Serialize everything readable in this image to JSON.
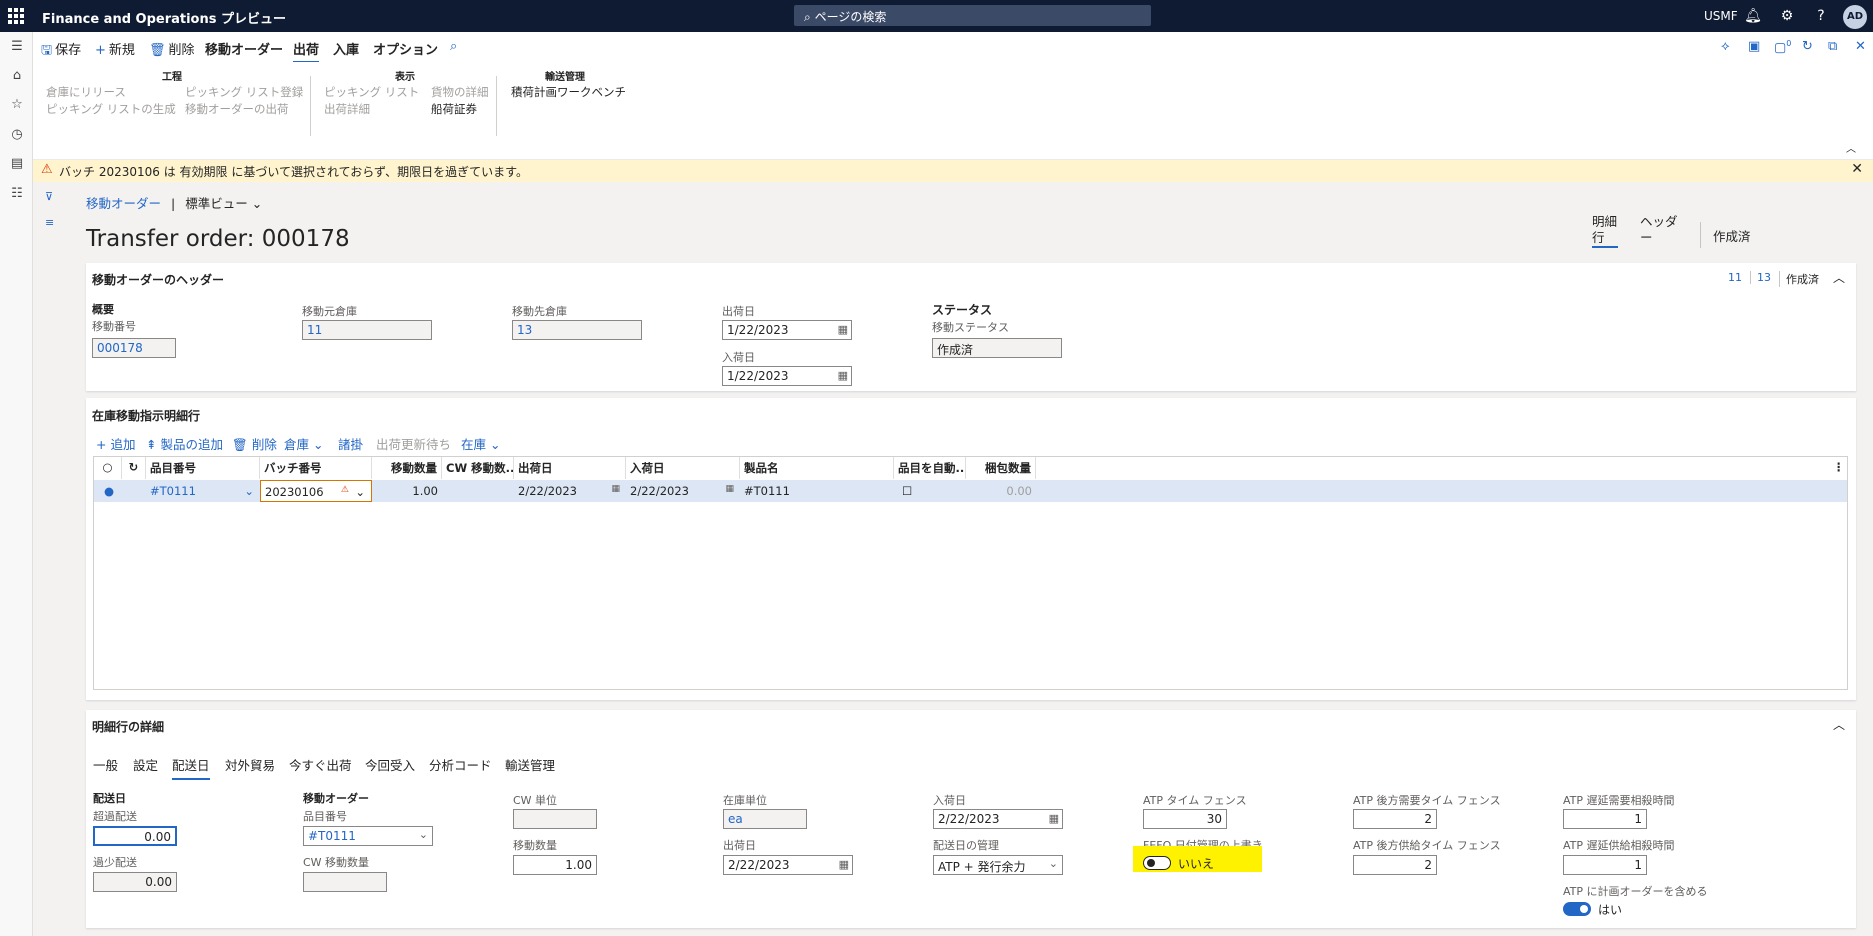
{
  "topbar": {
    "app_title": "Finance and Operations プレビュー",
    "search_placeholder": "ページの検索",
    "company": "USMF",
    "avatar": "AD"
  },
  "actionbar": {
    "save": "保存",
    "new": "新規",
    "delete": "削除",
    "transfer_order": "移動オーダー",
    "ship": "出荷",
    "receive": "入庫",
    "options": "オプション",
    "notification_count": "0"
  },
  "ribbon": {
    "groups": [
      {
        "title": "工程",
        "items": [
          "倉庫にリリース",
          "ピッキング リストの生成",
          "ピッキング リスト登録",
          "移動オーダーの出荷"
        ]
      },
      {
        "title": "表示",
        "items": [
          "ピッキング リスト",
          "出荷詳細",
          "貨物の詳細",
          "船荷証券"
        ]
      },
      {
        "title": "輸送管理",
        "items": [
          "積荷計画ワークベンチ"
        ]
      }
    ]
  },
  "warning": {
    "message": "バッチ 20230106 は 有効期限 に基づいて選択されておらず、期限日を過ぎています。"
  },
  "breadcrumb": {
    "link": "移動オーダー",
    "sep": "|",
    "view": "標準ビュー"
  },
  "page": {
    "title": "Transfer order: 000178",
    "view_tabs": [
      "明細行",
      "ヘッダー"
    ],
    "status": "作成済"
  },
  "header_card": {
    "title": "移動オーダーのヘッダー",
    "summary_from": "11",
    "summary_to": "13",
    "summary_status": "作成済",
    "overview_group": "概要",
    "order_number_label": "移動番号",
    "order_number": "000178",
    "from_wh_label": "移動元倉庫",
    "from_wh": "11",
    "to_wh_label": "移動先倉庫",
    "to_wh": "13",
    "ship_date_label": "出荷日",
    "ship_date": "1/22/2023",
    "receipt_date_label": "入荷日",
    "receipt_date": "1/22/2023",
    "status_group": "ステータス",
    "transfer_status_label": "移動ステータス",
    "transfer_status": "作成済"
  },
  "lines_card": {
    "title": "在庫移動指示明細行",
    "toolbar": {
      "add": "追加",
      "add_products": "製品の追加",
      "delete": "削除",
      "warehouse": "倉庫",
      "charges": "諸掛",
      "pending_update": "出荷更新待ち",
      "inventory": "在庫"
    },
    "columns": [
      "品目番号",
      "バッチ番号",
      "移動数量",
      "CW 移動数...",
      "出荷日",
      "入荷日",
      "製品名",
      "品目を自動...",
      "梱包数量"
    ],
    "rows": [
      {
        "item": "#T0111",
        "batch": "20230106",
        "qty": "1.00",
        "cw_qty": "",
        "ship_date": "2/22/2023",
        "receipt_date": "2/22/2023",
        "product_name": "#T0111",
        "pack_qty": "0.00"
      }
    ]
  },
  "details_card": {
    "title": "明細行の詳細",
    "tabs": [
      "一般",
      "設定",
      "配送日",
      "対外貿易",
      "今すぐ出荷",
      "今回受入",
      "分析コード",
      "輸送管理"
    ],
    "delivery_group": "配送日",
    "over_delivery_label": "超過配送",
    "over_delivery": "0.00",
    "under_delivery_label": "過少配送",
    "under_delivery": "0.00",
    "transfer_group": "移動オーダー",
    "item_number_label": "品目番号",
    "item_number": "#T0111",
    "cw_qty_label": "CW 移動数量",
    "cw_qty": "",
    "cw_unit_label": "CW 単位",
    "cw_unit": "",
    "transfer_qty_label": "移動数量",
    "transfer_qty": "1.00",
    "inventory_unit_label": "在庫単位",
    "inventory_unit": "ea",
    "ship_date_label": "出荷日",
    "ship_date": "2/22/2023",
    "receipt_date_label": "入荷日",
    "receipt_date": "2/22/2023",
    "delivery_control_label": "配送日の管理",
    "delivery_control": "ATP + 発行余力",
    "atp_fence_label": "ATP タイム フェンス",
    "atp_fence": "30",
    "fefo_label": "FEFO 日付管理の上書き",
    "fefo_value": "いいえ",
    "atp_backward_demand_label": "ATP 後方需要タイム フェンス",
    "atp_backward_demand": "2",
    "atp_backward_supply_label": "ATP 後方供給タイム フェンス",
    "atp_backward_supply": "2",
    "atp_delayed_demand_label": "ATP 遅延需要相殺時間",
    "atp_delayed_demand": "1",
    "atp_delayed_supply_label": "ATP 遅延供給相殺時間",
    "atp_delayed_supply": "1",
    "atp_planned_label": "ATP に計画オーダーを含める",
    "atp_planned_value": "はい"
  },
  "colors": {
    "accent": "#2266c6",
    "topbar": "#0f1b33",
    "warning_bg": "#fff4ce",
    "highlight": "#fff200"
  }
}
